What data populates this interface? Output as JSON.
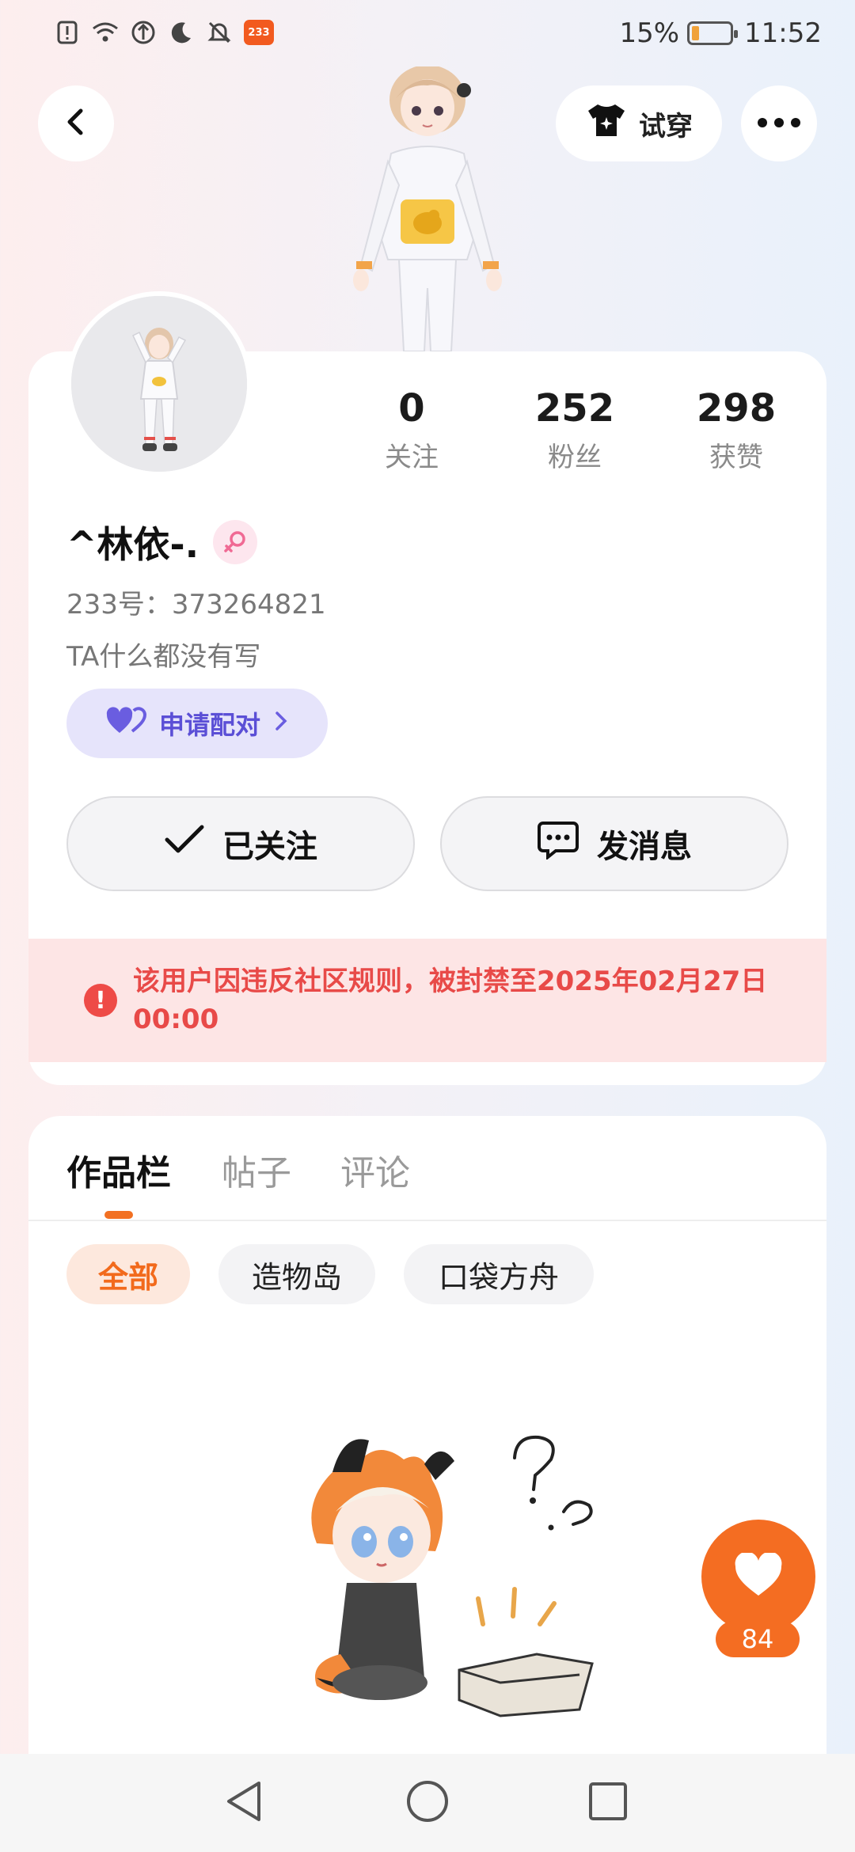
{
  "status_bar": {
    "notification_count": "233",
    "battery": "15%",
    "battery_level": 0.15,
    "time": "11:52",
    "icons": [
      "sim-alert-icon",
      "wifi-icon",
      "data-saver-icon",
      "moon-icon",
      "bell-off-icon",
      "app-233-icon"
    ]
  },
  "header": {
    "tryon_label": "试穿",
    "icons": {
      "back": "chevron-left-icon",
      "more": "more-dots-icon",
      "tryon": "shirt-sparkle-icon"
    }
  },
  "profile": {
    "nickname": "^林依-.",
    "uid_text": "233号：373264821",
    "bio": "TA什么都没有写",
    "stats": [
      {
        "value": "0",
        "label": "关注"
      },
      {
        "value": "252",
        "label": "粉丝"
      },
      {
        "value": "298",
        "label": "获赞"
      }
    ],
    "pair_label": "申请配对",
    "follow_label": "已关注",
    "message_label": "发消息",
    "ban_notice": "该用户因违反社区规则，被封禁至2025年02月27日 00:00"
  },
  "works": {
    "tabs": [
      {
        "label": "作品栏",
        "active": true
      },
      {
        "label": "帖子",
        "active": false
      },
      {
        "label": "评论",
        "active": false
      }
    ],
    "filters": [
      {
        "label": "全部",
        "active": true
      },
      {
        "label": "造物岛",
        "active": false
      },
      {
        "label": "口袋方舟",
        "active": false
      }
    ]
  },
  "like_fab": {
    "count": "84"
  },
  "colors": {
    "accent": "#f46d22",
    "ban_text": "#e84a48",
    "ban_bg": "#fde5e5",
    "pair_text": "#5b4fd6",
    "pair_bg": "#e6e4fb"
  }
}
